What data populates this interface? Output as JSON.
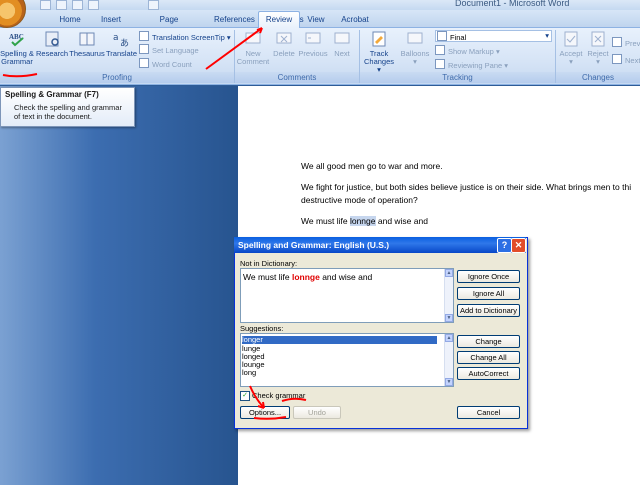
{
  "window": {
    "title": "Document1 - Microsoft Word"
  },
  "tabs": [
    "Home",
    "Insert",
    "Page Layout",
    "References",
    "Mailings",
    "Review",
    "View",
    "Acrobat"
  ],
  "active_tab": "Review",
  "ribbon": {
    "proofing": {
      "label": "Proofing",
      "spelling": "Spelling & Grammar",
      "research": "Research",
      "thesaurus": "Thesaurus",
      "translate": "Translate",
      "translation_screentip": "Translation ScreenTip",
      "set_language": "Set Language",
      "word_count": "Word Count"
    },
    "comments": {
      "label": "Comments",
      "new": "New Comment",
      "delete": "Delete",
      "previous": "Previous",
      "next": "Next"
    },
    "tracking": {
      "label": "Tracking",
      "track_changes": "Track Changes",
      "balloons": "Balloons",
      "display_value": "Final",
      "show_markup": "Show Markup",
      "reviewing_pane": "Reviewing Pane"
    },
    "changes": {
      "label": "Changes",
      "accept": "Accept",
      "reject": "Reject",
      "previous": "Previ",
      "next": "Next"
    }
  },
  "tooltip": {
    "title": "Spelling & Grammar (F7)",
    "body": "Check the spelling and grammar of text in the document."
  },
  "document": {
    "line1": "We all good men go to war and more.",
    "line2a": "We fight for justice, but both sides believe justice is on their side.  What brings men to thi",
    "line2b": "destructive mode of operation?",
    "line3_pre": "We must life ",
    "line3_err": "lonnge",
    "line3_post": " and wise  and"
  },
  "dialog": {
    "title": "Spelling and Grammar: English (U.S.)",
    "not_in_dict_label": "Not in Dictionary:",
    "sentence_pre": "We must life ",
    "sentence_err": "lonnge",
    "sentence_post": " and wise  and",
    "suggestions_label": "Suggestions:",
    "suggestions": [
      "longer",
      "lunge",
      "longed",
      "lounge",
      "long"
    ],
    "selected_index": 0,
    "check_grammar_label": "Check grammar",
    "check_grammar_checked": true,
    "buttons": {
      "ignore_once": "Ignore Once",
      "ignore_all": "Ignore All",
      "add_to_dictionary": "Add to Dictionary",
      "change": "Change",
      "change_all": "Change All",
      "autocorrect": "AutoCorrect",
      "options": "Options...",
      "undo": "Undo",
      "cancel": "Cancel"
    }
  },
  "colors": {
    "accent": "#0a5fe0",
    "error": "#e00000",
    "annotation": "#ff0000",
    "selection": "#316ac5"
  }
}
